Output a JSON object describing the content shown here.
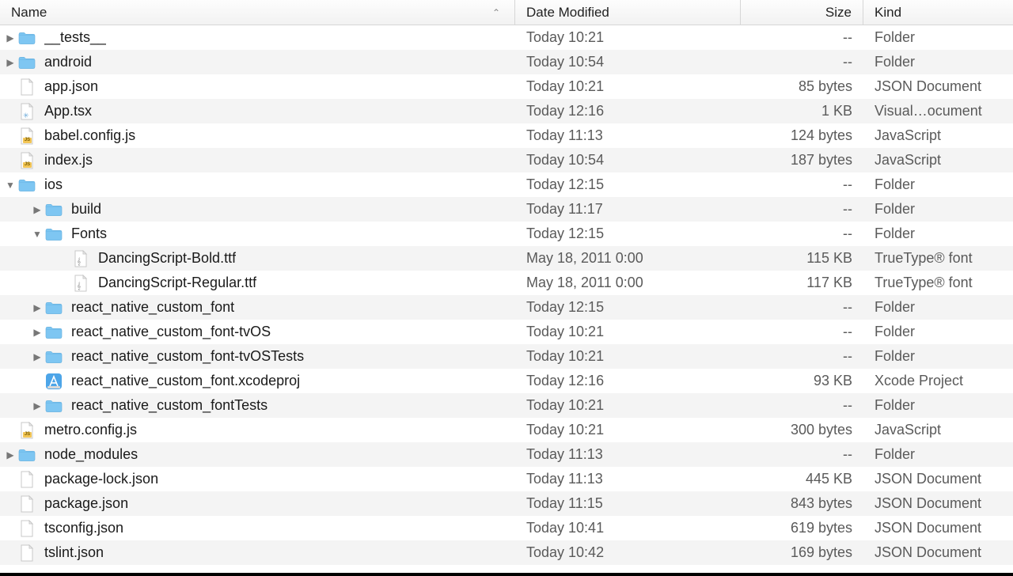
{
  "columns": {
    "name": "Name",
    "date": "Date Modified",
    "size": "Size",
    "kind": "Kind"
  },
  "rows": [
    {
      "depth": 0,
      "disc": "closed",
      "icon": "folder",
      "name": "__tests__",
      "date": "Today 10:21",
      "size": "--",
      "kind": "Folder"
    },
    {
      "depth": 0,
      "disc": "closed",
      "icon": "folder",
      "name": "android",
      "date": "Today 10:54",
      "size": "--",
      "kind": "Folder"
    },
    {
      "depth": 0,
      "disc": "none",
      "icon": "file",
      "name": "app.json",
      "date": "Today 10:21",
      "size": "85 bytes",
      "kind": "JSON Document"
    },
    {
      "depth": 0,
      "disc": "none",
      "icon": "react",
      "name": "App.tsx",
      "date": "Today 12:16",
      "size": "1 KB",
      "kind": "Visual…ocument"
    },
    {
      "depth": 0,
      "disc": "none",
      "icon": "js",
      "name": "babel.config.js",
      "date": "Today 11:13",
      "size": "124 bytes",
      "kind": "JavaScript"
    },
    {
      "depth": 0,
      "disc": "none",
      "icon": "js",
      "name": "index.js",
      "date": "Today 10:54",
      "size": "187 bytes",
      "kind": "JavaScript"
    },
    {
      "depth": 0,
      "disc": "open",
      "icon": "folder",
      "name": "ios",
      "date": "Today 12:15",
      "size": "--",
      "kind": "Folder"
    },
    {
      "depth": 1,
      "disc": "closed",
      "icon": "folder",
      "name": "build",
      "date": "Today 11:17",
      "size": "--",
      "kind": "Folder"
    },
    {
      "depth": 1,
      "disc": "open",
      "icon": "folder",
      "name": "Fonts",
      "date": "Today 12:15",
      "size": "--",
      "kind": "Folder"
    },
    {
      "depth": 2,
      "disc": "none",
      "icon": "font",
      "name": "DancingScript-Bold.ttf",
      "date": "May 18, 2011 0:00",
      "size": "115 KB",
      "kind": "TrueType® font"
    },
    {
      "depth": 2,
      "disc": "none",
      "icon": "font",
      "name": "DancingScript-Regular.ttf",
      "date": "May 18, 2011 0:00",
      "size": "117 KB",
      "kind": "TrueType® font"
    },
    {
      "depth": 1,
      "disc": "closed",
      "icon": "folder",
      "name": "react_native_custom_font",
      "date": "Today 12:15",
      "size": "--",
      "kind": "Folder"
    },
    {
      "depth": 1,
      "disc": "closed",
      "icon": "folder",
      "name": "react_native_custom_font-tvOS",
      "date": "Today 10:21",
      "size": "--",
      "kind": "Folder"
    },
    {
      "depth": 1,
      "disc": "closed",
      "icon": "folder",
      "name": "react_native_custom_font-tvOSTests",
      "date": "Today 10:21",
      "size": "--",
      "kind": "Folder"
    },
    {
      "depth": 1,
      "disc": "none",
      "icon": "xcode",
      "name": "react_native_custom_font.xcodeproj",
      "date": "Today 12:16",
      "size": "93 KB",
      "kind": "Xcode Project"
    },
    {
      "depth": 1,
      "disc": "closed",
      "icon": "folder",
      "name": "react_native_custom_fontTests",
      "date": "Today 10:21",
      "size": "--",
      "kind": "Folder"
    },
    {
      "depth": 0,
      "disc": "none",
      "icon": "js",
      "name": "metro.config.js",
      "date": "Today 10:21",
      "size": "300 bytes",
      "kind": "JavaScript"
    },
    {
      "depth": 0,
      "disc": "closed",
      "icon": "folder",
      "name": "node_modules",
      "date": "Today 11:13",
      "size": "--",
      "kind": "Folder"
    },
    {
      "depth": 0,
      "disc": "none",
      "icon": "file",
      "name": "package-lock.json",
      "date": "Today 11:13",
      "size": "445 KB",
      "kind": "JSON Document"
    },
    {
      "depth": 0,
      "disc": "none",
      "icon": "file",
      "name": "package.json",
      "date": "Today 11:15",
      "size": "843 bytes",
      "kind": "JSON Document"
    },
    {
      "depth": 0,
      "disc": "none",
      "icon": "file",
      "name": "tsconfig.json",
      "date": "Today 10:41",
      "size": "619 bytes",
      "kind": "JSON Document"
    },
    {
      "depth": 0,
      "disc": "none",
      "icon": "file",
      "name": "tslint.json",
      "date": "Today 10:42",
      "size": "169 bytes",
      "kind": "JSON Document"
    }
  ]
}
